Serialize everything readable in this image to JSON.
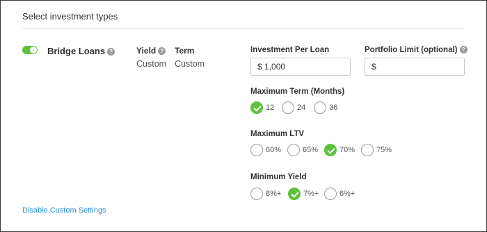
{
  "section": {
    "title": "Select investment types"
  },
  "product": {
    "name": "Bridge Loans",
    "enabled": true,
    "yield_label": "Yield",
    "yield_value": "Custom",
    "term_label": "Term",
    "term_value": "Custom"
  },
  "investment_per_loan": {
    "label": "Investment Per Loan",
    "value": "$ 1,000"
  },
  "portfolio_limit": {
    "label": "Portfolio Limit (optional)",
    "value": "",
    "placeholder": "$"
  },
  "maximum_term": {
    "label": "Maximum Term (Months)",
    "options": [
      {
        "label": "12",
        "checked": true
      },
      {
        "label": "24",
        "checked": false
      },
      {
        "label": "36",
        "checked": false
      }
    ]
  },
  "maximum_ltv": {
    "label": "Maximum LTV",
    "options": [
      {
        "label": "60%",
        "checked": false
      },
      {
        "label": "65%",
        "checked": false
      },
      {
        "label": "70%",
        "checked": true
      },
      {
        "label": "75%",
        "checked": false
      }
    ]
  },
  "minimum_yield": {
    "label": "Minimum Yield",
    "options": [
      {
        "label": "8%+",
        "checked": false
      },
      {
        "label": "7%+",
        "checked": true
      },
      {
        "label": "6%+",
        "checked": false
      }
    ]
  },
  "footer": {
    "disable_link": "Disable Custom Settings"
  },
  "colors": {
    "accent_green": "#5cc23b",
    "link_blue": "#2f8fd6"
  }
}
